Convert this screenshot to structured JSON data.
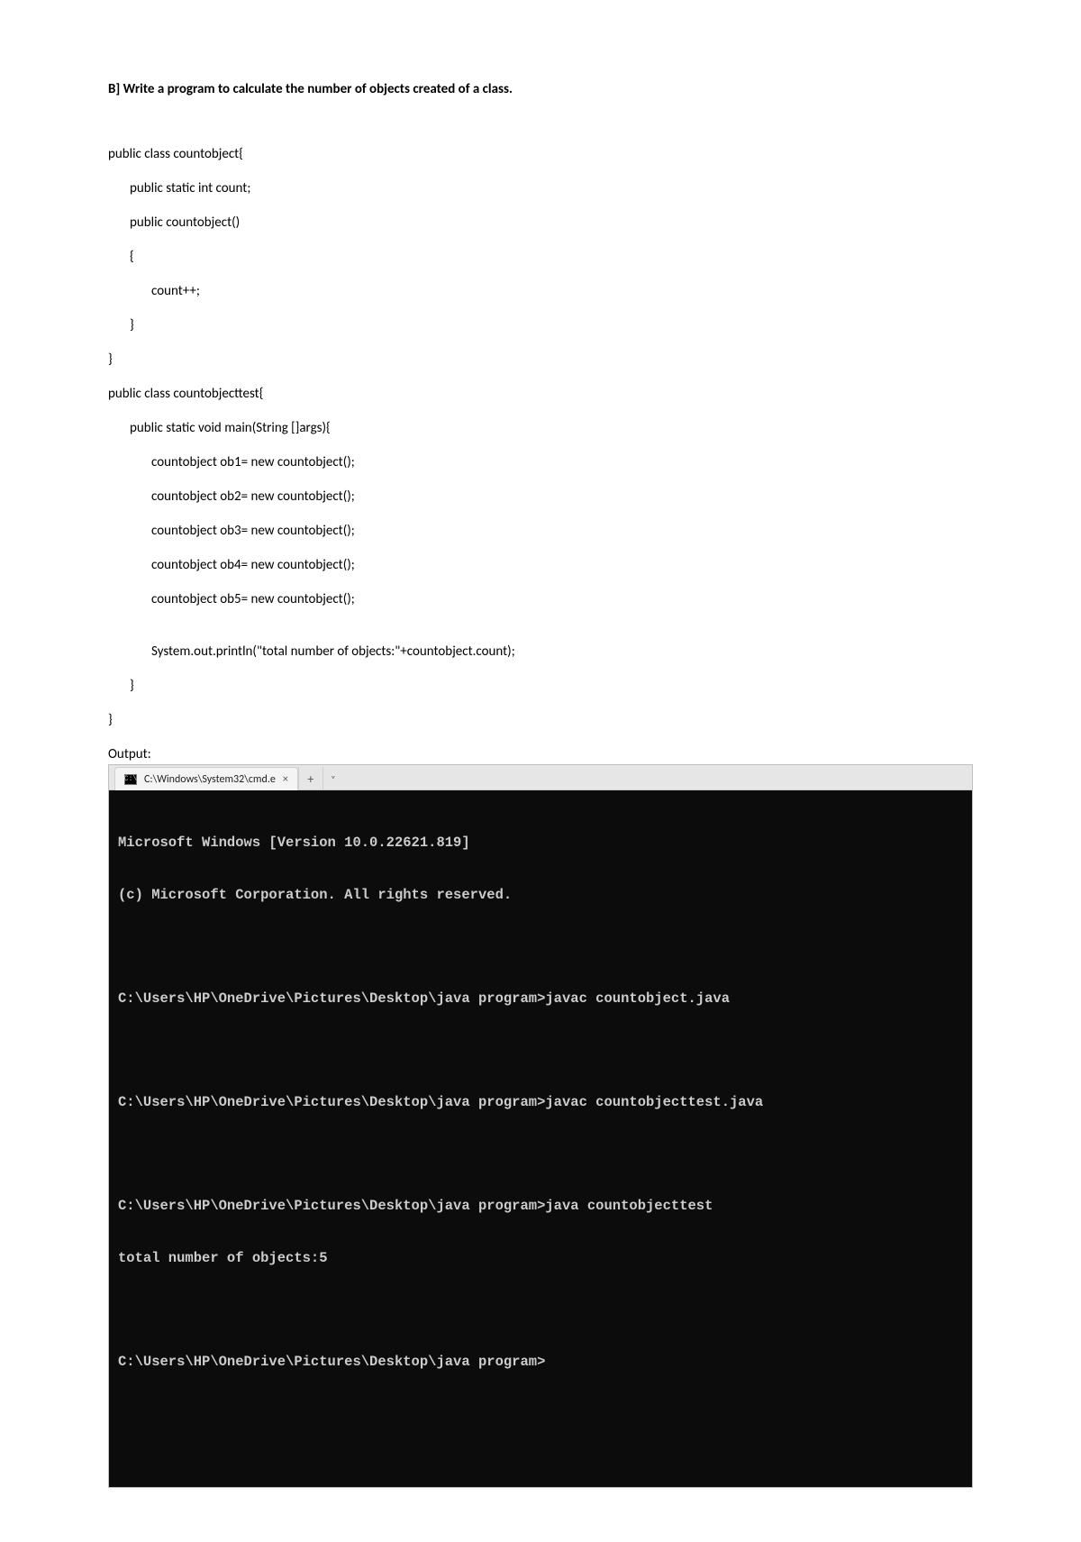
{
  "heading": "B] Write a program to calculate the number of objects created of a class.",
  "code": {
    "l1": "public class countobject{",
    "l2": "public static int count;",
    "l3": "public countobject()",
    "l4": "{",
    "l5": "count++;",
    "l6": "}",
    "l7": "}",
    "l8": "public class countobjecttest{",
    "l9": "public static void main(String []args){",
    "l10": "countobject ob1= new countobject();",
    "l11": "countobject ob2= new countobject();",
    "l12": "countobject ob3= new countobject();",
    "l13": "countobject ob4= new countobject();",
    "l14": "countobject ob5= new countobject();",
    "l15": "System.out.println(\"total number of objects:\"+countobject.count);",
    "l16": "}",
    "l17": "}"
  },
  "output_label": "Output:",
  "terminal": {
    "tab_title": "C:\\Windows\\System32\\cmd.e",
    "tab_close": "×",
    "tab_new": "+",
    "tab_dropdown": "˅",
    "tab_icon_text": "C:\\",
    "lines": {
      "l1": "Microsoft Windows [Version 10.0.22621.819]",
      "l2": "(c) Microsoft Corporation. All rights reserved.",
      "l3": "C:\\Users\\HP\\OneDrive\\Pictures\\Desktop\\java program>javac countobject.java",
      "l4": "C:\\Users\\HP\\OneDrive\\Pictures\\Desktop\\java program>javac countobjecttest.java",
      "l5": "C:\\Users\\HP\\OneDrive\\Pictures\\Desktop\\java program>java countobjecttest",
      "l6": "total number of objects:5",
      "l7": "C:\\Users\\HP\\OneDrive\\Pictures\\Desktop\\java program>"
    }
  }
}
